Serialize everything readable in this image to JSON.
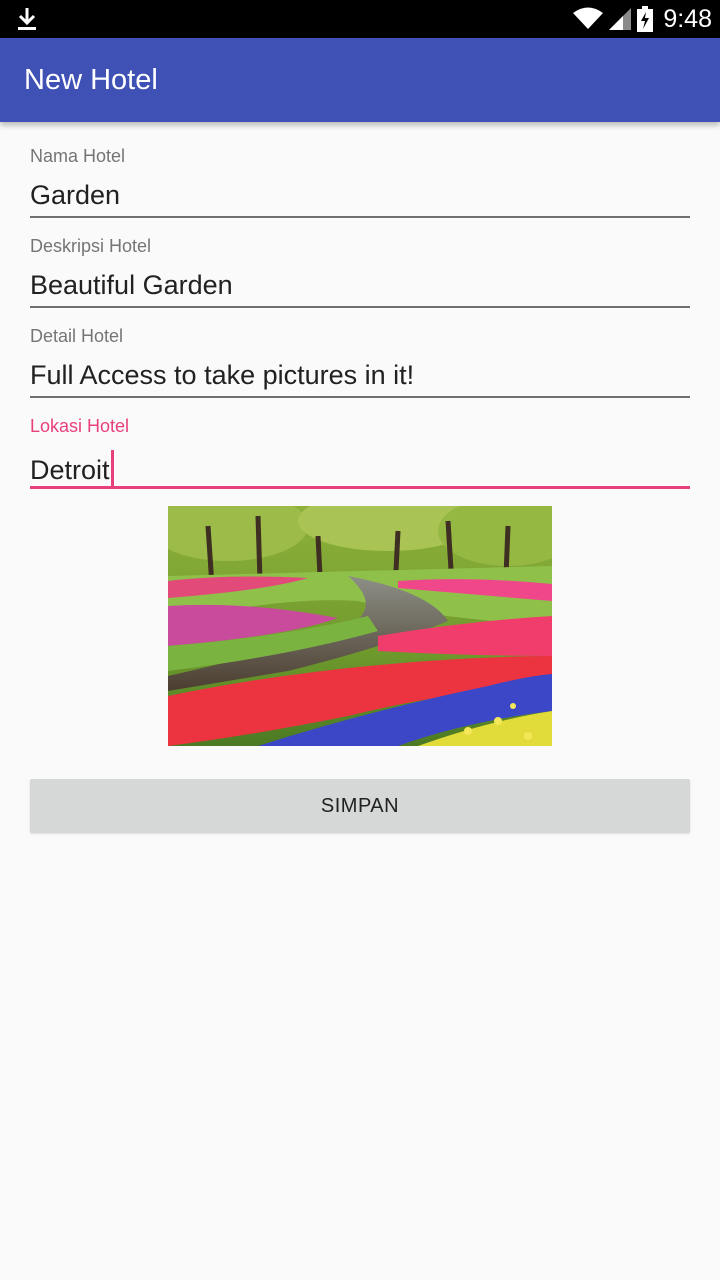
{
  "status_bar": {
    "time": "9:48",
    "icons": [
      "download-icon",
      "wifi-icon",
      "cell-signal-icon",
      "battery-charging-icon"
    ]
  },
  "app_bar": {
    "title": "New Hotel",
    "color": "#3f51b5"
  },
  "form": {
    "fields": [
      {
        "label": "Nama Hotel",
        "value": "Garden"
      },
      {
        "label": "Deskripsi Hotel",
        "value": "Beautiful Garden"
      },
      {
        "label": "Detail Hotel",
        "value": "Full Access to take pictures in it!"
      },
      {
        "label": "Lokasi Hotel",
        "value": "Detroit",
        "focused": true
      }
    ],
    "accent_color": "#e8407d"
  },
  "photo": {
    "subject": "tulip-garden-photo"
  },
  "save_button": {
    "label": "SIMPAN"
  }
}
